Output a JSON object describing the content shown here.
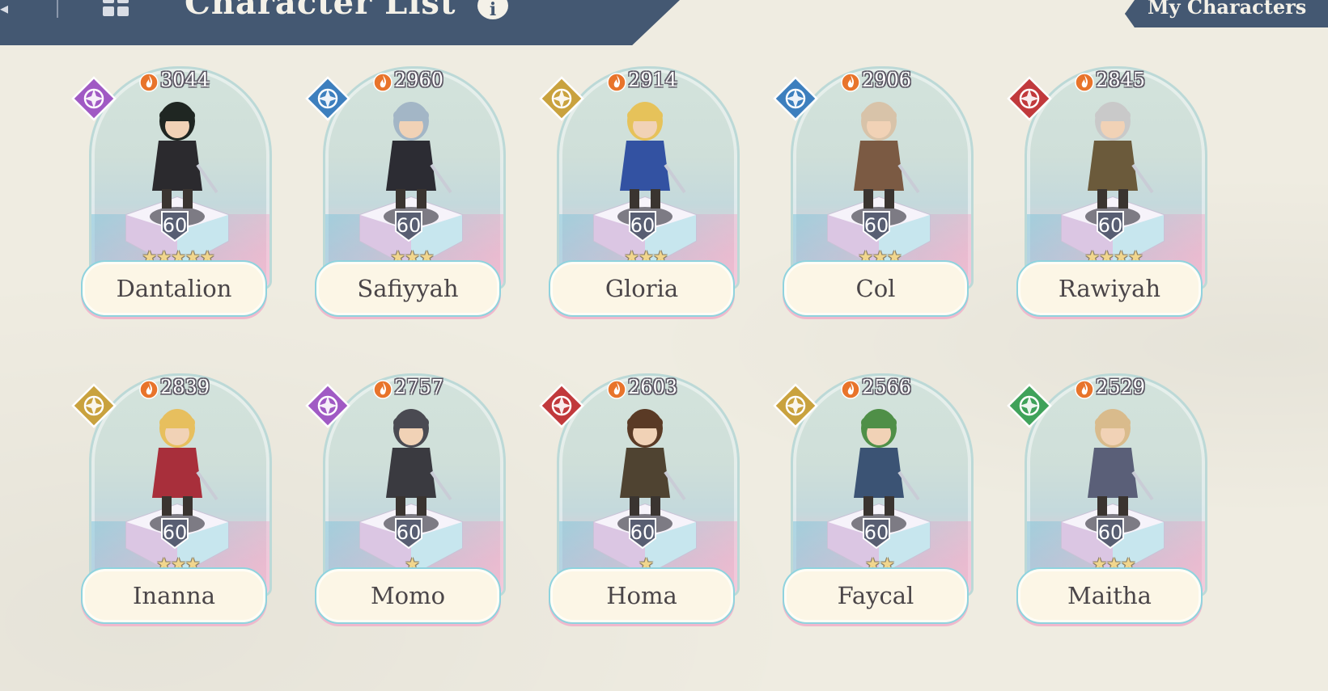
{
  "header": {
    "title": "Character List",
    "info_glyph": "i",
    "back_glyph": "◂",
    "colors": {
      "bar": "#445872",
      "text": "#f4f1e8"
    }
  },
  "my_characters_button": {
    "label": "My Characters"
  },
  "characters": [
    {
      "name": "Dantalion",
      "power": "3044",
      "level": "60",
      "stars": 5,
      "element": "arcane",
      "element_color": "#a05ac4",
      "outfit": "#2b2a2e",
      "hair": "#1f2622"
    },
    {
      "name": "Safiyyah",
      "power": "2960",
      "level": "60",
      "stars": 3,
      "element": "wind",
      "element_color": "#3d7fbe",
      "outfit": "#2c2c33",
      "hair": "#a3b6c6"
    },
    {
      "name": "Gloria",
      "power": "2914",
      "level": "60",
      "stars": 3,
      "element": "light",
      "element_color": "#c9a23e",
      "outfit": "#3352a2",
      "hair": "#e6c25a"
    },
    {
      "name": "Col",
      "power": "2906",
      "level": "60",
      "stars": 3,
      "element": "wind",
      "element_color": "#3d7fbe",
      "outfit": "#7b5a43",
      "hair": "#d8c3a9"
    },
    {
      "name": "Rawiyah",
      "power": "2845",
      "level": "60",
      "stars": 4,
      "element": "fire",
      "element_color": "#c1393c",
      "outfit": "#6b5a3b",
      "hair": "#c9c9c9"
    },
    {
      "name": "Inanna",
      "power": "2839",
      "level": "60",
      "stars": 3,
      "element": "light",
      "element_color": "#c9a23e",
      "outfit": "#a82f3b",
      "hair": "#e7bf5e"
    },
    {
      "name": "Momo",
      "power": "2757",
      "level": "60",
      "stars": 1,
      "element": "arcane",
      "element_color": "#a05ac4",
      "outfit": "#3a3a40",
      "hair": "#4a4a52"
    },
    {
      "name": "Homa",
      "power": "2603",
      "level": "60",
      "stars": 1,
      "element": "fire",
      "element_color": "#c1393c",
      "outfit": "#4f4331",
      "hair": "#5a3a25"
    },
    {
      "name": "Faycal",
      "power": "2566",
      "level": "60",
      "stars": 2,
      "element": "light",
      "element_color": "#c9a23e",
      "outfit": "#3b5374",
      "hair": "#4f8f47"
    },
    {
      "name": "Maitha",
      "power": "2529",
      "level": "60",
      "stars": 3,
      "element": "nature",
      "element_color": "#3fa25a",
      "outfit": "#5a5f78",
      "hair": "#d9bb8c"
    }
  ]
}
